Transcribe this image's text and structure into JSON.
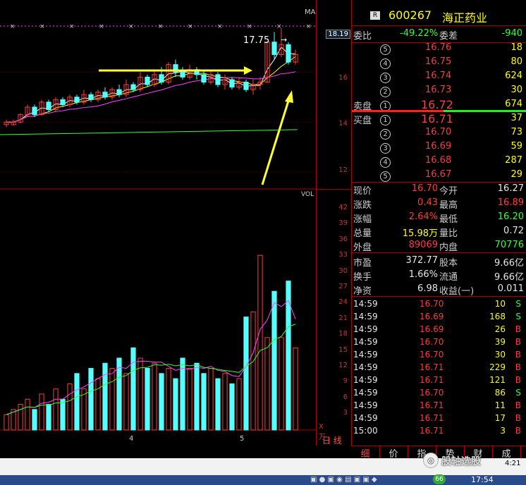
{
  "stock": {
    "badge": "R",
    "code": "600267",
    "name": "海正药业"
  },
  "chart": {
    "ma_label": "MA",
    "price_high_label": "17.75",
    "vol_label": "VOL",
    "vol_unit": "X万",
    "date_labels": [
      "4",
      "5"
    ],
    "price_axis": [
      "18.19",
      "16",
      "14",
      "12"
    ],
    "vol_axis": [
      "42",
      "39",
      "36",
      "33",
      "30",
      "27",
      "24",
      "21",
      "18",
      "15",
      "12",
      "9",
      "6",
      "3"
    ],
    "day_line_tab": "日 线"
  },
  "chart_data": {
    "type": "candlestick",
    "price_ylim": [
      11.5,
      18.6
    ],
    "vol_ylim": [
      0,
      45
    ],
    "candles": [
      [
        13.9,
        14.0,
        13.8,
        14.1
      ],
      [
        13.9,
        14.0,
        13.85,
        14.1
      ],
      [
        14.0,
        14.3,
        13.95,
        14.35
      ],
      [
        14.3,
        14.6,
        14.25,
        14.7
      ],
      [
        14.6,
        14.3,
        14.2,
        14.7
      ],
      [
        14.3,
        14.8,
        14.25,
        14.9
      ],
      [
        14.8,
        14.5,
        14.4,
        14.9
      ],
      [
        14.5,
        14.9,
        14.4,
        15.0
      ],
      [
        14.9,
        14.7,
        14.6,
        15.0
      ],
      [
        14.7,
        15.0,
        14.6,
        15.1
      ],
      [
        15.0,
        14.8,
        14.7,
        15.1
      ],
      [
        14.8,
        15.1,
        14.7,
        15.3
      ],
      [
        15.1,
        14.9,
        14.8,
        15.2
      ],
      [
        14.9,
        15.2,
        14.8,
        15.3
      ],
      [
        15.2,
        15.0,
        14.9,
        15.4
      ],
      [
        15.0,
        15.3,
        14.9,
        15.4
      ],
      [
        15.3,
        15.1,
        15.0,
        15.5
      ],
      [
        15.1,
        15.5,
        15.0,
        15.7
      ],
      [
        15.5,
        15.3,
        15.2,
        15.6
      ],
      [
        15.3,
        15.8,
        15.2,
        16.0
      ],
      [
        15.8,
        15.5,
        15.4,
        15.9
      ],
      [
        15.5,
        15.9,
        15.4,
        16.1
      ],
      [
        15.9,
        15.6,
        15.5,
        16.2
      ],
      [
        15.6,
        16.3,
        15.5,
        16.4
      ],
      [
        16.3,
        16.0,
        15.8,
        16.5
      ],
      [
        16.0,
        15.8,
        15.7,
        16.2
      ],
      [
        15.8,
        16.1,
        15.7,
        16.3
      ],
      [
        16.1,
        15.9,
        15.7,
        16.2
      ],
      [
        15.9,
        15.6,
        15.5,
        16.1
      ],
      [
        15.6,
        15.9,
        15.5,
        16.1
      ],
      [
        15.9,
        15.5,
        15.4,
        16.0
      ],
      [
        15.5,
        15.7,
        15.3,
        15.9
      ],
      [
        15.7,
        15.4,
        15.3,
        15.8
      ],
      [
        15.4,
        15.6,
        15.3,
        15.8
      ],
      [
        15.6,
        15.3,
        15.2,
        15.7
      ],
      [
        15.3,
        15.5,
        15.1,
        15.7
      ],
      [
        15.5,
        15.6,
        15.3,
        15.8
      ],
      [
        15.6,
        17.2,
        15.6,
        17.2
      ],
      [
        17.2,
        16.7,
        16.5,
        17.6
      ],
      [
        16.7,
        17.1,
        16.6,
        17.75
      ],
      [
        17.1,
        16.4,
        16.3,
        17.2
      ],
      [
        16.4,
        16.7,
        16.3,
        16.9
      ]
    ],
    "volumes": [
      3,
      4,
      5,
      6,
      4,
      7,
      5,
      8,
      6,
      9,
      11,
      8,
      12,
      10,
      13,
      12,
      14,
      11,
      16,
      14,
      12,
      13,
      11,
      12,
      10,
      14,
      12,
      13,
      11,
      12,
      10,
      11,
      9,
      10,
      22,
      23,
      34,
      18,
      27,
      18,
      29,
      16
    ]
  },
  "quote": {
    "weibi_label": "委比",
    "weibi_value": "-49.22%",
    "weicha_label": "委差",
    "weicha_value": "-940",
    "sell_label": "卖盘",
    "buy_label": "买盘",
    "sells": [
      {
        "n": "5",
        "price": "16.76",
        "vol": "18"
      },
      {
        "n": "4",
        "price": "16.75",
        "vol": "80"
      },
      {
        "n": "3",
        "price": "16.74",
        "vol": "624"
      },
      {
        "n": "2",
        "price": "16.73",
        "vol": "30"
      },
      {
        "n": "1",
        "price": "16.72",
        "vol": "674"
      }
    ],
    "buys": [
      {
        "n": "1",
        "price": "16.71",
        "vol": "37"
      },
      {
        "n": "2",
        "price": "16.70",
        "vol": "73"
      },
      {
        "n": "3",
        "price": "16.69",
        "vol": "59"
      },
      {
        "n": "4",
        "price": "16.68",
        "vol": "287"
      },
      {
        "n": "5",
        "price": "16.67",
        "vol": "29"
      }
    ],
    "stats": [
      {
        "l1": "现价",
        "v1": "16.70",
        "l2": "今开",
        "v2": "16.27"
      },
      {
        "l1": "涨跌",
        "v1": "0.43",
        "l2": "最高",
        "v2": "16.89"
      },
      {
        "l1": "涨幅",
        "v1": "2.64%",
        "l2": "最低",
        "v2": "16.20"
      },
      {
        "l1": "总量",
        "v1": "15.98万",
        "l2": "量比",
        "v2": "0.72"
      },
      {
        "l1": "外盘",
        "v1": "89069",
        "l2": "内盘",
        "v2": "70776"
      },
      {
        "l1": "市盈",
        "v1": "372.77",
        "l2": "股本",
        "v2": "9.66亿"
      },
      {
        "l1": "换手",
        "v1": "1.66%",
        "l2": "流通",
        "v2": "9.66亿"
      },
      {
        "l1": "净资",
        "v1": "6.98",
        "l2": "收益(一)",
        "v2": "0.011"
      }
    ],
    "ticks": [
      {
        "t": "14:59",
        "p": "16.70",
        "v": "10",
        "s": "S"
      },
      {
        "t": "14:59",
        "p": "16.69",
        "v": "168",
        "s": "S"
      },
      {
        "t": "14:59",
        "p": "16.69",
        "v": "26",
        "s": "B"
      },
      {
        "t": "14:59",
        "p": "16.70",
        "v": "39",
        "s": "B"
      },
      {
        "t": "14:59",
        "p": "16.70",
        "v": "30",
        "s": "B"
      },
      {
        "t": "14:59",
        "p": "16.71",
        "v": "229",
        "s": "B"
      },
      {
        "t": "14:59",
        "p": "16.71",
        "v": "121",
        "s": "B"
      },
      {
        "t": "14:59",
        "p": "16.70",
        "v": "86",
        "s": "S"
      },
      {
        "t": "14:59",
        "p": "16.71",
        "v": "11",
        "s": "B"
      },
      {
        "t": "14:59",
        "p": "16.71",
        "v": "17",
        "s": "B"
      },
      {
        "t": "15:00",
        "p": "16.71",
        "v": "3",
        "s": "B"
      }
    ]
  },
  "tabs": [
    "细",
    "价",
    "指",
    "势",
    "财",
    "成"
  ],
  "taskbar": {
    "watermark": "股轴选股",
    "clock": "17:54",
    "clock_small": "4:21"
  },
  "colors": {
    "up": "#ff3b3b",
    "down": "#55ffff",
    "ma1": "#ffffff",
    "ma2": "#ffff00",
    "ma3": "#ff44ff",
    "ma4": "#33ff33",
    "arrow": "#ffff33"
  }
}
